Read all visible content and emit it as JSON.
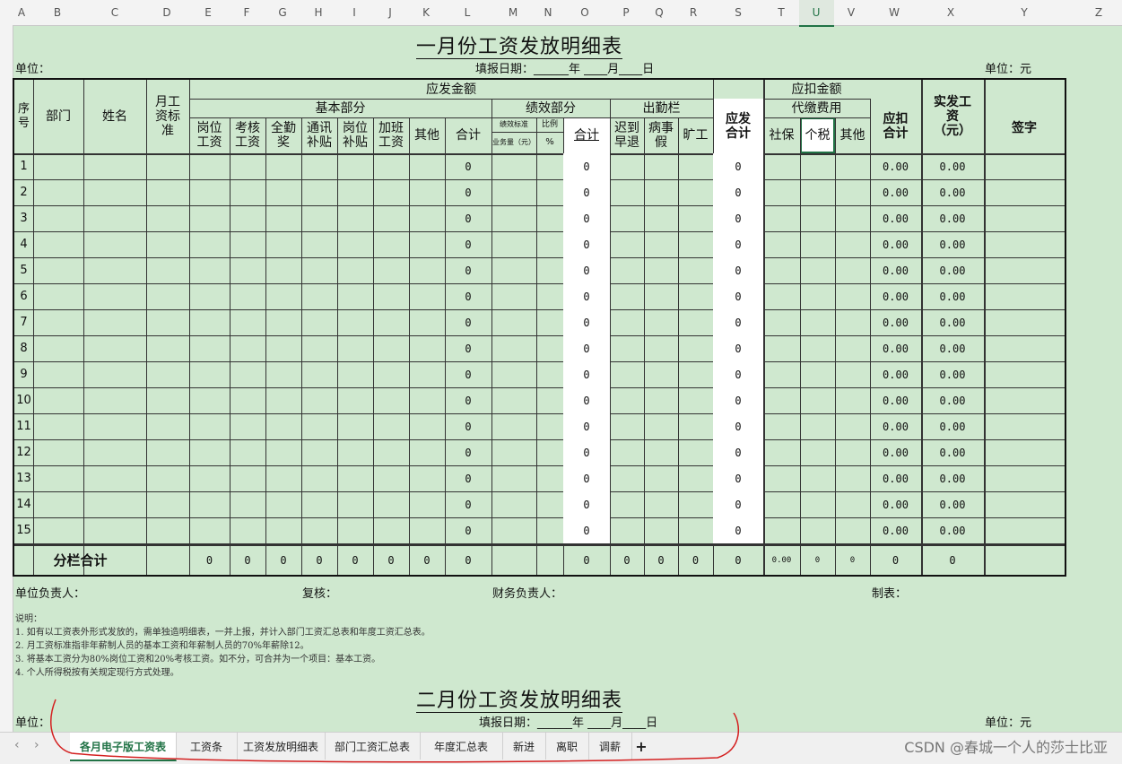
{
  "columns": [
    "A",
    "B",
    "C",
    "D",
    "E",
    "F",
    "G",
    "H",
    "I",
    "J",
    "K",
    "L",
    "M",
    "N",
    "O",
    "P",
    "Q",
    "R",
    "S",
    "T",
    "U",
    "V",
    "W",
    "X",
    "Y",
    "Z"
  ],
  "selected_column": "U",
  "title_1": "一月份工资发放明细表",
  "title_2": "二月份工资发放明细表",
  "unit_left": "单位：",
  "unit_right": "单位：元",
  "fill_date": "填报日期：______年 ____月____日",
  "header": {
    "seq": "序号",
    "dept": "部门",
    "name": "姓名",
    "monthly_std": "月工资标准",
    "payable": "应发金额",
    "basic": "基本部分",
    "perf": "绩效部分",
    "attend": "出勤栏",
    "post_wage": "岗位工资",
    "assess_wage": "考核工资",
    "full_attend": "全勤奖",
    "comm_allow": "通讯补贴",
    "post_allow": "岗位补贴",
    "overtime": "加班工资",
    "other": "其他",
    "subtotal": "合计",
    "perf_std": "绩效标准",
    "perf_ratio": "比例",
    "perf_biz": "业务量（元）",
    "perf_pct": "%",
    "perf_subtotal": "合计",
    "late": "迟到早退",
    "sick": "病事假",
    "absent": "旷工",
    "payable_total": "应发合计",
    "deduct": "应扣金额",
    "agent_fee": "代缴费用",
    "social": "社保",
    "tax": "个税",
    "deduct_other": "其他",
    "deduct_total": "应扣合计",
    "net_pay": "实发工资（元）",
    "sign": "签字"
  },
  "rows": [
    {
      "seq": "1",
      "l": "0",
      "o": "0",
      "s": "0",
      "w": "0.00",
      "x": "0.00"
    },
    {
      "seq": "2",
      "l": "0",
      "o": "0",
      "s": "0",
      "w": "0.00",
      "x": "0.00"
    },
    {
      "seq": "3",
      "l": "0",
      "o": "0",
      "s": "0",
      "w": "0.00",
      "x": "0.00"
    },
    {
      "seq": "4",
      "l": "0",
      "o": "0",
      "s": "0",
      "w": "0.00",
      "x": "0.00"
    },
    {
      "seq": "5",
      "l": "0",
      "o": "0",
      "s": "0",
      "w": "0.00",
      "x": "0.00"
    },
    {
      "seq": "6",
      "l": "0",
      "o": "0",
      "s": "0",
      "w": "0.00",
      "x": "0.00"
    },
    {
      "seq": "7",
      "l": "0",
      "o": "0",
      "s": "0",
      "w": "0.00",
      "x": "0.00"
    },
    {
      "seq": "8",
      "l": "0",
      "o": "0",
      "s": "0",
      "w": "0.00",
      "x": "0.00"
    },
    {
      "seq": "9",
      "l": "0",
      "o": "0",
      "s": "0",
      "w": "0.00",
      "x": "0.00"
    },
    {
      "seq": "10",
      "l": "0",
      "o": "0",
      "s": "0",
      "w": "0.00",
      "x": "0.00"
    },
    {
      "seq": "11",
      "l": "0",
      "o": "0",
      "s": "0",
      "w": "0.00",
      "x": "0.00"
    },
    {
      "seq": "12",
      "l": "0",
      "o": "0",
      "s": "0",
      "w": "0.00",
      "x": "0.00"
    },
    {
      "seq": "13",
      "l": "0",
      "o": "0",
      "s": "0",
      "w": "0.00",
      "x": "0.00"
    },
    {
      "seq": "14",
      "l": "0",
      "o": "0",
      "s": "0",
      "w": "0.00",
      "x": "0.00"
    },
    {
      "seq": "15",
      "l": "0",
      "o": "0",
      "s": "0",
      "w": "0.00",
      "x": "0.00"
    }
  ],
  "total_row": {
    "label": "分栏合计",
    "e": "0",
    "f": "0",
    "g": "0",
    "h": "0",
    "i": "0",
    "j": "0",
    "k": "0",
    "l": "0",
    "o": "0",
    "p": "0",
    "q": "0",
    "r": "0",
    "s": "0",
    "t": "0.00",
    "u": "0",
    "v": "0",
    "w": "0",
    "x": "0"
  },
  "signoff": {
    "leader": "单位负责人：",
    "review": "复核：",
    "finance": "财务负责人：",
    "maker": "制表："
  },
  "notes": [
    "说明：",
    "1. 如有以工资表外形式发放的，需单独造明细表，一并上报，并计入部门工资汇总表和年度工资汇总表。",
    "2. 月工资标准指非年薪制人员的基本工资和年薪制人员的70%年薪除12。",
    "3. 将基本工资分为80%岗位工资和20%考核工资。如不分，可合并为一个项目：基本工资。",
    "4. 个人所得税按有关规定现行方式处理。"
  ],
  "tabs": [
    "各月电子版工资表",
    "工资条",
    "工资发放明细表",
    "部门工资汇总表",
    "年度汇总表",
    "新进",
    "离职",
    "调薪",
    "+"
  ],
  "active_tab": "各月电子版工资表",
  "watermark": "CSDN @春城一个人的莎士比亚"
}
